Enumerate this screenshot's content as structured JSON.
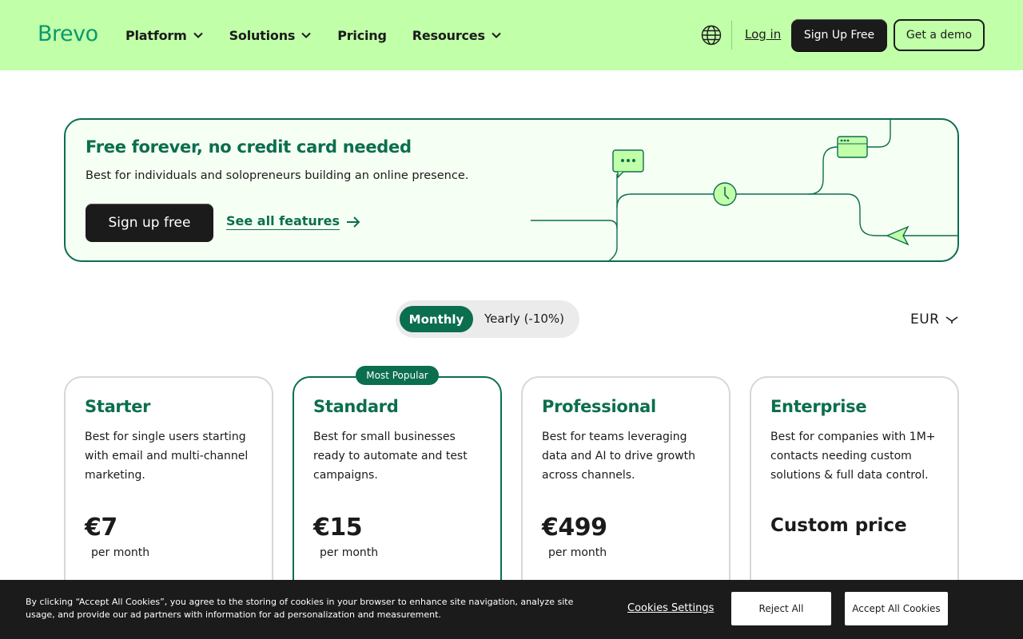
{
  "header": {
    "logo": "Brevo",
    "nav": [
      {
        "label": "Platform",
        "has_dropdown": true
      },
      {
        "label": "Solutions",
        "has_dropdown": true
      },
      {
        "label": "Pricing",
        "has_dropdown": false
      },
      {
        "label": "Resources",
        "has_dropdown": true
      }
    ],
    "globe_icon": "globe-icon",
    "login": "Log in",
    "signup": "Sign Up Free",
    "demo": "Get a demo"
  },
  "free_plan": {
    "title": "Free forever, no credit card needed",
    "subtitle": "Best for individuals and solopreneurs building an online presence.",
    "cta": "Sign up free",
    "link": "See all features"
  },
  "billing": {
    "monthly": "Monthly",
    "yearly": "Yearly (-10%)",
    "selected": "Monthly",
    "currency": "EUR"
  },
  "plans": [
    {
      "name": "Starter",
      "desc": "Best for single users starting with email and multi-channel marketing.",
      "price": "€7",
      "per": "per month"
    },
    {
      "name": "Standard",
      "badge": "Most Popular",
      "desc": "Best for small businesses ready to automate and test campaigns.",
      "price": "€15",
      "per": "per month"
    },
    {
      "name": "Professional",
      "desc": "Best for teams leveraging data and AI to drive growth across channels.",
      "price": "€499",
      "per": "per month"
    },
    {
      "name": "Enterprise",
      "desc": "Best for companies with 1M+ contacts needing custom solutions & full data control.",
      "price": "Custom price",
      "per": ""
    }
  ],
  "cookie": {
    "text": "By clicking “Accept All Cookies”, you agree to the storing of cookies in your browser to enhance site navigation, analyze site usage, and provide our ad partners with information for ad personalization and measurement.",
    "settings": "Cookies Settings",
    "reject": "Reject All",
    "accept": "Accept All Cookies"
  },
  "colors": {
    "header_bg": "#c1ffa9",
    "brand_green": "#0b6e4f",
    "logo_green": "#0b996e",
    "dark": "#1b1b1b"
  }
}
